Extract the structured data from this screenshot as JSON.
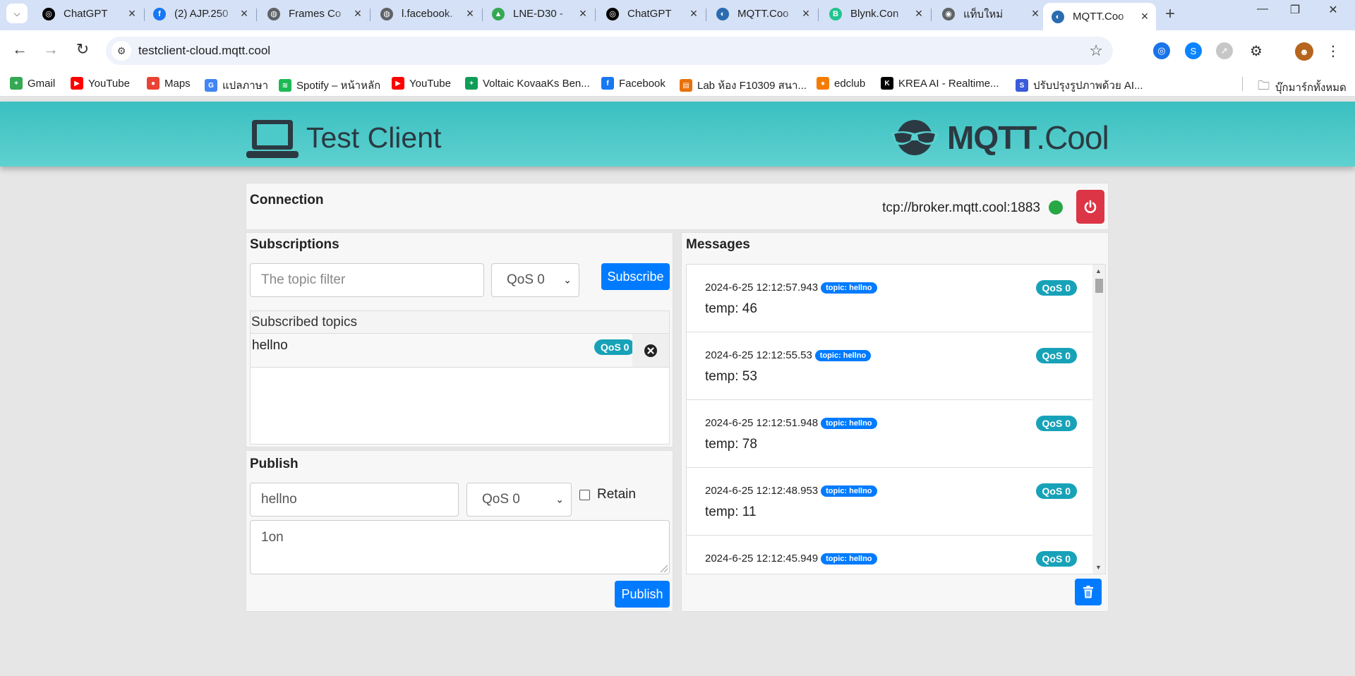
{
  "browser": {
    "tabs": [
      {
        "title": "ChatGPT",
        "icon": "chatgpt-icon",
        "color": "#000000",
        "glyph": "◎"
      },
      {
        "title": "(2) AJP.250",
        "icon": "facebook-icon",
        "color": "#1877f2",
        "glyph": "f"
      },
      {
        "title": "Frames Co",
        "icon": "globe-icon",
        "color": "#5f6368",
        "glyph": "◍"
      },
      {
        "title": "l.facebook.",
        "icon": "globe-icon",
        "color": "#5f6368",
        "glyph": "◍"
      },
      {
        "title": "LNE-D30 -",
        "icon": "google-drive-icon",
        "color": "#34a853",
        "glyph": "▲"
      },
      {
        "title": "ChatGPT",
        "icon": "chatgpt-icon",
        "color": "#000000",
        "glyph": "◎"
      },
      {
        "title": "MQTT.Coo",
        "icon": "mqtt-icon",
        "color": "#2b6cb0",
        "glyph": "◐"
      },
      {
        "title": "Blynk.Con",
        "icon": "blynk-icon",
        "color": "#23c48e",
        "glyph": "B"
      },
      {
        "title": "แท็บใหม่",
        "icon": "chrome-icon",
        "color": "#5f6368",
        "glyph": "◉"
      },
      {
        "title": "MQTT.Coo",
        "icon": "mqtt-icon",
        "color": "#2b6cb0",
        "glyph": "◐",
        "active": true
      }
    ],
    "url": "testclient-cloud.mqtt.cool",
    "bookmarks": [
      {
        "label": "Gmail",
        "icon": "gmail-icon",
        "color": "#34a853",
        "glyph": "+"
      },
      {
        "label": "YouTube",
        "icon": "youtube-icon",
        "color": "#ff0000",
        "glyph": "▶"
      },
      {
        "label": "Maps",
        "icon": "maps-icon",
        "color": "#ea4335",
        "glyph": "●"
      },
      {
        "label": "แปลภาษา",
        "icon": "translate-icon",
        "color": "#4285f4",
        "glyph": "G"
      },
      {
        "label": "Spotify – หน้าหลัก",
        "icon": "spotify-icon",
        "color": "#1db954",
        "glyph": "≋"
      },
      {
        "label": "YouTube",
        "icon": "youtube-icon",
        "color": "#ff0000",
        "glyph": "▶"
      },
      {
        "label": "Voltaic KovaaKs Ben...",
        "icon": "sheets-icon",
        "color": "#0f9d58",
        "glyph": "+"
      },
      {
        "label": "Facebook",
        "icon": "facebook-icon",
        "color": "#1877f2",
        "glyph": "f"
      },
      {
        "label": "Lab ห้อง F10309 สนา...",
        "icon": "lab-icon",
        "color": "#e8710a",
        "glyph": "▤"
      },
      {
        "label": "edclub",
        "icon": "edclub-icon",
        "color": "#f57c00",
        "glyph": "●"
      },
      {
        "label": "KREA AI - Realtime...",
        "icon": "krea-icon",
        "color": "#000000",
        "glyph": "K"
      },
      {
        "label": "ปรับปรุงรูปภาพด้วย AI...",
        "icon": "image-ai-icon",
        "color": "#3b5bdb",
        "glyph": "S"
      }
    ],
    "all_bookmarks_label": "บุ๊กมาร์กทั้งหมด"
  },
  "header": {
    "title": "Test Client",
    "logo_text_bold": "MQTT",
    "logo_text_light": ".Cool"
  },
  "connection": {
    "title": "Connection",
    "broker": "tcp://broker.mqtt.cool:1883",
    "status_color": "#28a745"
  },
  "subscriptions": {
    "title": "Subscriptions",
    "topic_placeholder": "The topic filter",
    "qos_selected": "QoS 0",
    "subscribe_label": "Subscribe",
    "list_title": "Subscribed topics",
    "items": [
      {
        "topic": "hellno",
        "qos": "QoS 0"
      }
    ]
  },
  "publish": {
    "title": "Publish",
    "topic_value": "hellno",
    "qos_selected": "QoS 0",
    "retain_label": "Retain",
    "retain_checked": false,
    "payload": "1on",
    "publish_label": "Publish"
  },
  "messages": {
    "title": "Messages",
    "items": [
      {
        "timestamp": "2024-6-25 12:12:57.943",
        "topic_badge": "topic: hellno",
        "qos": "QoS 0",
        "payload": "temp: 46"
      },
      {
        "timestamp": "2024-6-25 12:12:55.53",
        "topic_badge": "topic: hellno",
        "qos": "QoS 0",
        "payload": "temp: 53"
      },
      {
        "timestamp": "2024-6-25 12:12:51.948",
        "topic_badge": "topic: hellno",
        "qos": "QoS 0",
        "payload": "temp: 78"
      },
      {
        "timestamp": "2024-6-25 12:12:48.953",
        "topic_badge": "topic: hellno",
        "qos": "QoS 0",
        "payload": "temp: 11"
      },
      {
        "timestamp": "2024-6-25 12:12:45.949",
        "topic_badge": "topic: hellno",
        "qos": "QoS 0",
        "payload": ""
      }
    ]
  }
}
